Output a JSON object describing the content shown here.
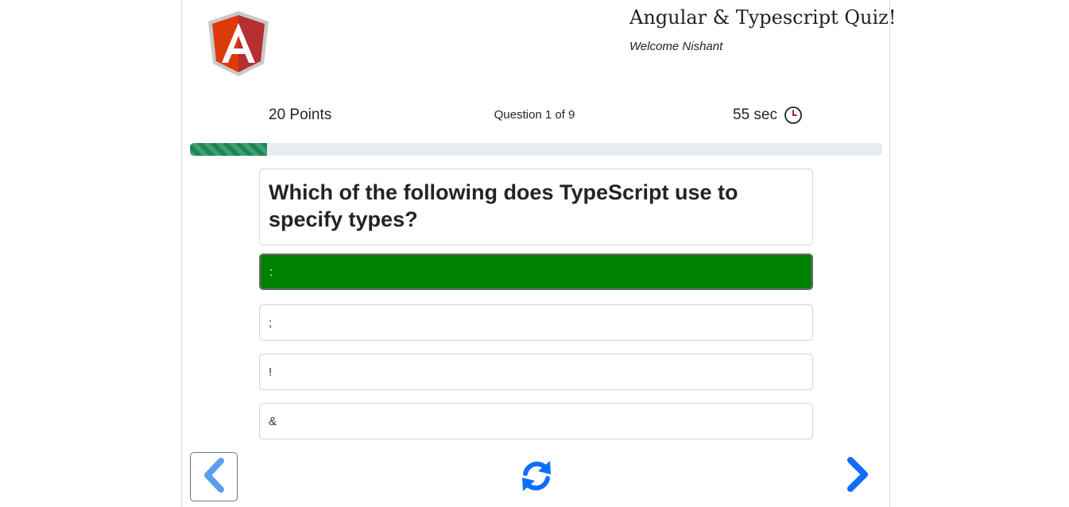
{
  "header": {
    "title": "Angular & Typescript Quiz!",
    "welcome": "Welcome Nishant",
    "logo_icon": "angular-logo-icon"
  },
  "stats": {
    "points": "20 Points",
    "question_counter": "Question 1 of 9",
    "timer": "55 sec",
    "timer_icon": "clock-icon"
  },
  "progress": {
    "fraction": 0.111,
    "color": "#198754"
  },
  "question": {
    "text": "Which of the following does TypeScript use to specify types?"
  },
  "options": [
    {
      "label": ":",
      "selected": true
    },
    {
      "label": ";",
      "selected": false
    },
    {
      "label": "!",
      "selected": false
    },
    {
      "label": "&",
      "selected": false
    }
  ],
  "navigation": {
    "prev_icon": "chevron-left-icon",
    "reset_icon": "refresh-icon",
    "next_icon": "chevron-right-icon"
  },
  "colors": {
    "selected_option": "#008000",
    "accent_blue": "#0d6efd",
    "prev_blue": "#5c9cf0"
  }
}
